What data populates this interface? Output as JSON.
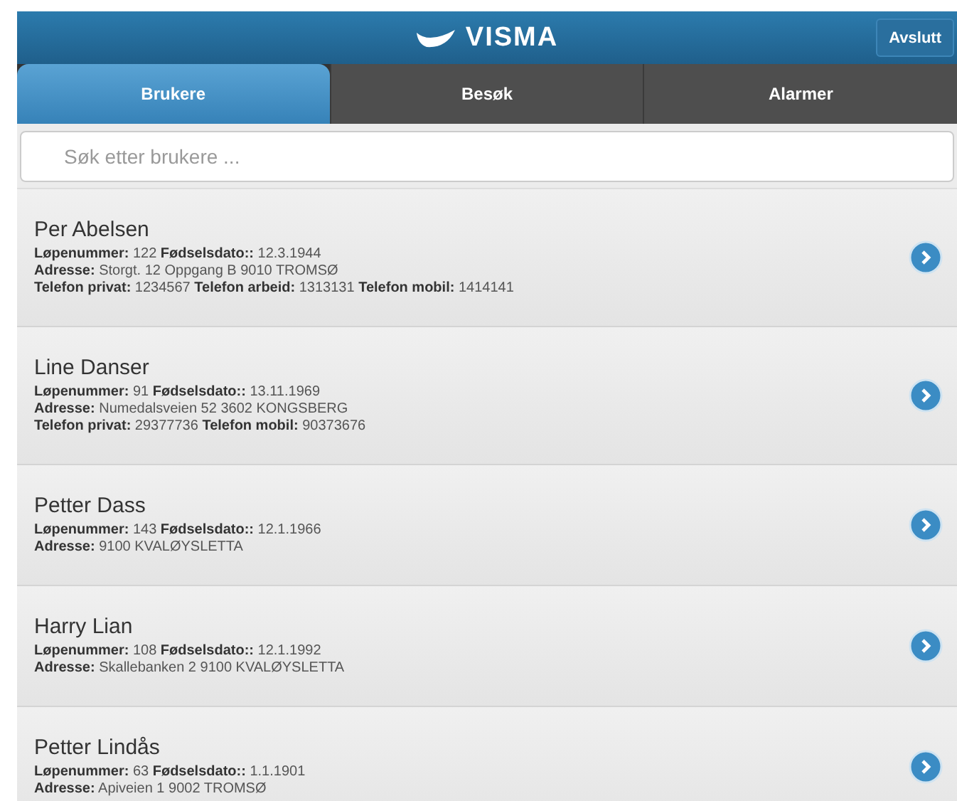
{
  "header": {
    "logo_text": "VISMA",
    "exit_button": "Avslutt"
  },
  "tabs": [
    {
      "label": "Brukere",
      "selected": true
    },
    {
      "label": "Besøk",
      "selected": false
    },
    {
      "label": "Alarmer",
      "selected": false
    }
  ],
  "search": {
    "placeholder": "Søk etter brukere ..."
  },
  "users": [
    {
      "name": "Per Abelsen",
      "details": [
        "**Løpenummer:** 122 **Fødselsdato::** 12.3.1944",
        "**Adresse:** Storgt. 12 Oppgang B 9010 TROMSØ",
        "**Telefon privat:** 1234567 **Telefon arbeid:** 1313131 **Telefon mobil:** 1414141"
      ]
    },
    {
      "name": "Line Danser",
      "details": [
        "**Løpenummer:** 91 **Fødselsdato::** 13.11.1969",
        "**Adresse:** Numedalsveien 52 3602 KONGSBERG",
        "**Telefon privat:** 29377736 **Telefon mobil:** 90373676"
      ]
    },
    {
      "name": "Petter Dass",
      "details": [
        "**Løpenummer:** 143 **Fødselsdato::** 12.1.1966",
        "**Adresse:** 9100 KVALØYSLETTA"
      ]
    },
    {
      "name": "Harry Lian",
      "details": [
        "**Løpenummer:** 108 **Fødselsdato::** 12.1.1992",
        "**Adresse:** Skallebanken 2 9100 KVALØYSLETTA"
      ]
    },
    {
      "name": "Petter Lindås",
      "details": [
        "**Løpenummer:** 63 **Fødselsdato::** 1.1.1901",
        "**Adresse:** Apiveien 1 9002 TROMSØ"
      ]
    }
  ]
}
